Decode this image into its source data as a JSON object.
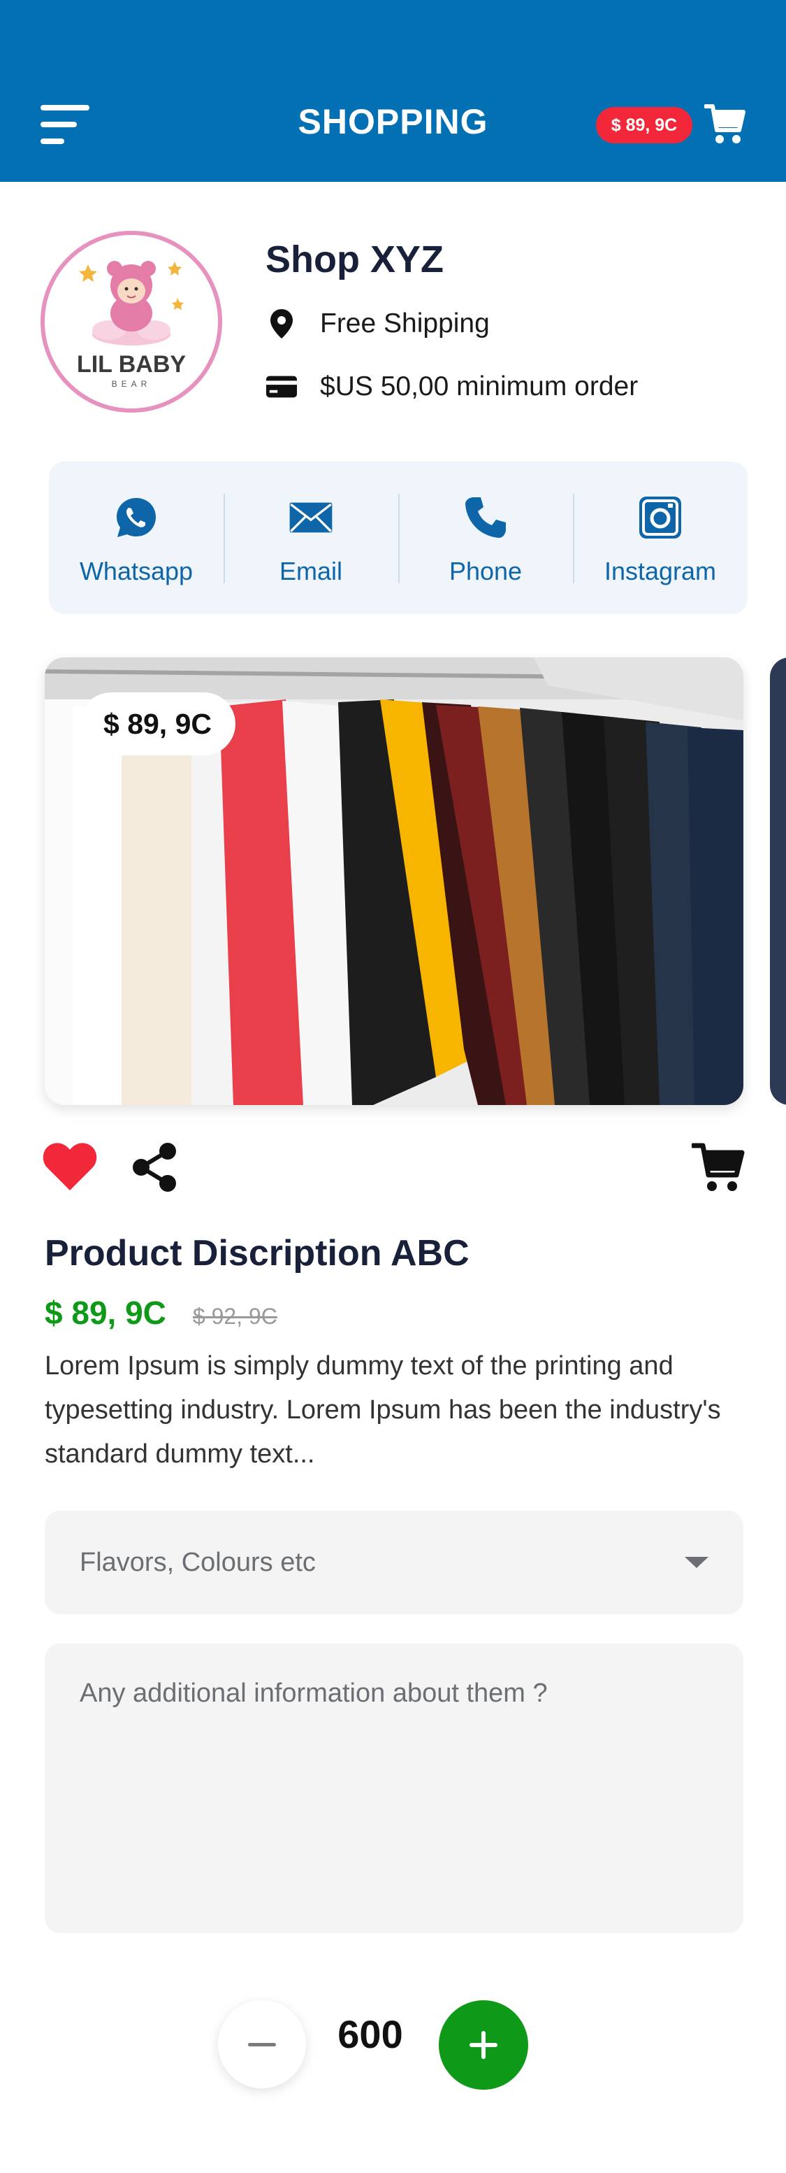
{
  "header": {
    "title": "SHOPPING",
    "cart_total": "$ 89, 9C",
    "menu_icon": "menu-icon",
    "cart_icon": "cart-icon"
  },
  "shop": {
    "name": "Shop XYZ",
    "logo_text": "LIL BABY",
    "logo_subtext": "BEAR",
    "shipping": "Free Shipping",
    "minimum_order": "$US 50,00 minimum order"
  },
  "contacts": [
    {
      "label": "Whatsapp",
      "icon": "whatsapp-icon"
    },
    {
      "label": "Email",
      "icon": "email-icon"
    },
    {
      "label": "Phone",
      "icon": "phone-icon"
    },
    {
      "label": "Instagram",
      "icon": "instagram-icon"
    }
  ],
  "product": {
    "price_tag": "$ 89, 9C",
    "title": "Product Discription ABC",
    "price": "$ 89, 9C",
    "old_price": "$ 92, 9C",
    "description": "Lorem Ipsum is simply dummy text of the printing and typesetting industry. Lorem Ipsum has been the industry's standard dummy text..."
  },
  "form": {
    "options_placeholder": "Flavors, Colours etc",
    "notes_placeholder": "Any additional information about them ?"
  },
  "quantity": {
    "value": "600"
  },
  "colors": {
    "header": "#0470B4",
    "badge": "#F2283A",
    "accent_green": "#0E9A18",
    "link_blue": "#0E66A8",
    "heart": "#F2283A"
  }
}
